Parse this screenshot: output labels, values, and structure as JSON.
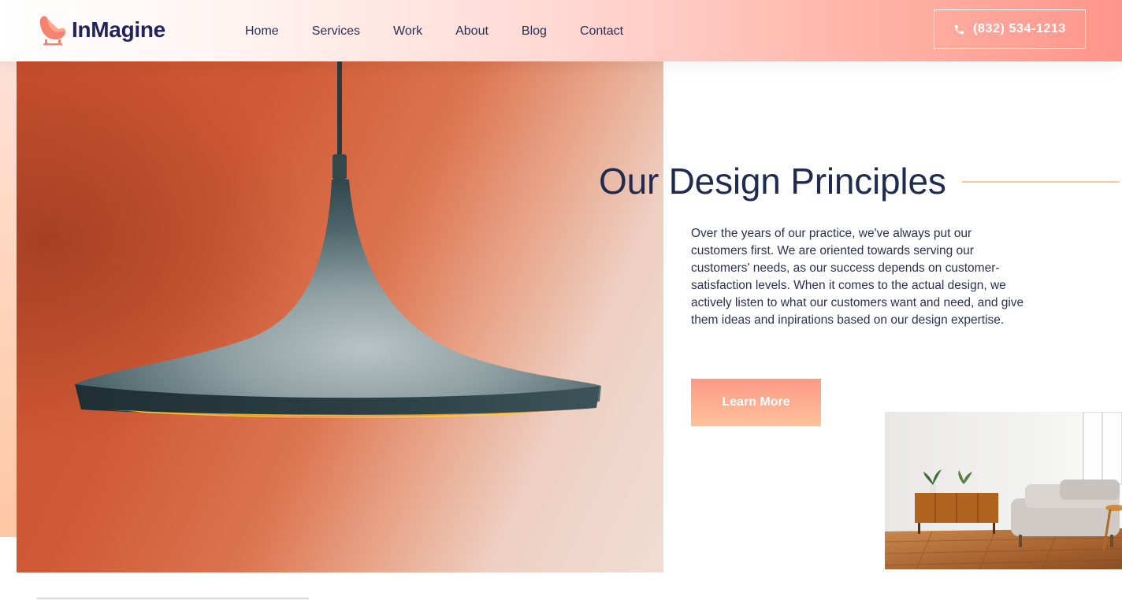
{
  "header": {
    "logo_text": "InMagine",
    "logo_icon": "armchair-icon",
    "nav": [
      {
        "label": "Home"
      },
      {
        "label": "Services"
      },
      {
        "label": "Work"
      },
      {
        "label": "About"
      },
      {
        "label": "Blog"
      },
      {
        "label": "Contact"
      }
    ],
    "phone": {
      "label": "(832) 534-1213",
      "icon": "phone-icon"
    }
  },
  "section": {
    "title": "Our Design Principles",
    "body": "Over the years of our practice, we've always put our customers first. We are oriented towards serving our customers' needs, as our success depends on customer-satisfaction levels. When it comes to the actual design, we actively listen to what our customers want and need, and give them ideas and inpirations based on our design expertise.",
    "button_label": "Learn More"
  },
  "colors": {
    "brand_navy": "#20245a",
    "accent_coral": "#ff958a",
    "accent_peach": "#ffc19a",
    "title_line": "#f8c7a2"
  }
}
